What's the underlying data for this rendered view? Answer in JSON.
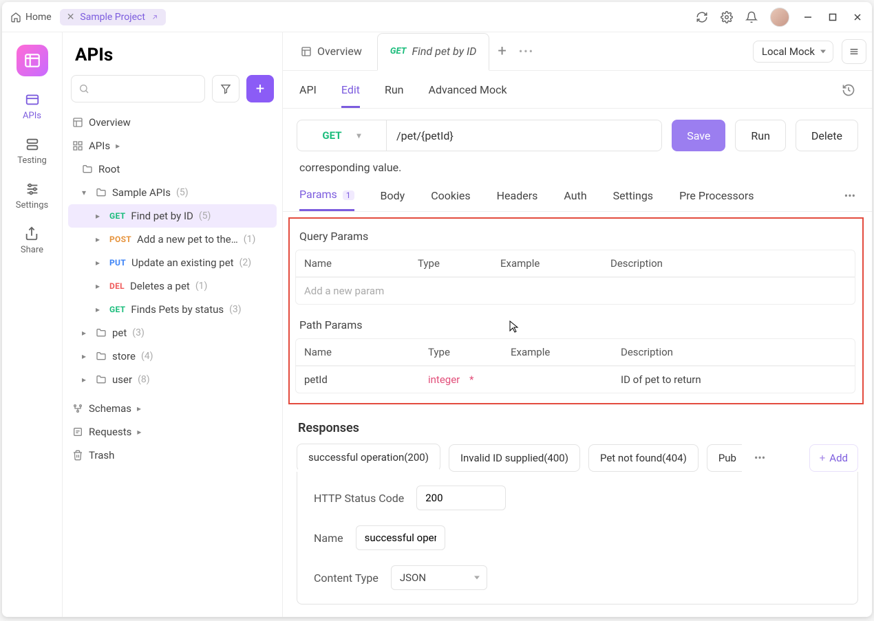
{
  "titlebar": {
    "home": "Home",
    "project_tab": "Sample Project"
  },
  "rail": {
    "items": [
      "APIs",
      "Testing",
      "Settings",
      "Share"
    ]
  },
  "sidebar": {
    "title": "APIs",
    "overview": "Overview",
    "apis_label": "APIs",
    "root": "Root",
    "sample_apis": {
      "label": "Sample APIs",
      "count": "(5)"
    },
    "endpoints": [
      {
        "method": "GET",
        "mclass": "m-get",
        "label": "Find pet by ID",
        "count": "(5)"
      },
      {
        "method": "POST",
        "mclass": "m-post",
        "label": "Add a new pet to the…",
        "count": "(1)"
      },
      {
        "method": "PUT",
        "mclass": "m-put",
        "label": "Update an existing pet",
        "count": "(2)"
      },
      {
        "method": "DEL",
        "mclass": "m-del",
        "label": "Deletes a pet",
        "count": "(1)"
      },
      {
        "method": "GET",
        "mclass": "m-get",
        "label": "Finds Pets by status",
        "count": "(3)"
      }
    ],
    "folders": [
      {
        "label": "pet",
        "count": "(3)"
      },
      {
        "label": "store",
        "count": "(4)"
      },
      {
        "label": "user",
        "count": "(8)"
      }
    ],
    "schemas": "Schemas",
    "requests": "Requests",
    "trash": "Trash"
  },
  "tabs": {
    "overview": "Overview",
    "active_method": "GET",
    "active_label": "Find pet by ID",
    "env": "Local Mock"
  },
  "inner_tabs": [
    "API",
    "Edit",
    "Run",
    "Advanced Mock"
  ],
  "action": {
    "method": "GET",
    "url": "/pet/{petId}",
    "save": "Save",
    "run": "Run",
    "delete": "Delete"
  },
  "description": "corresponding value.",
  "param_tabs": {
    "params": "Params",
    "params_count": "1",
    "body": "Body",
    "cookies": "Cookies",
    "headers": "Headers",
    "auth": "Auth",
    "settings": "Settings",
    "pre": "Pre Processors"
  },
  "query": {
    "section": "Query Params",
    "cols": {
      "name": "Name",
      "type": "Type",
      "example": "Example",
      "desc": "Description"
    },
    "placeholder": "Add a new param"
  },
  "path": {
    "section": "Path Params",
    "cols": {
      "name": "Name",
      "type": "Type",
      "example": "Example",
      "desc": "Description"
    },
    "row": {
      "name": "petId",
      "type": "integer",
      "example": "",
      "desc": "ID of pet to return"
    }
  },
  "responses": {
    "heading": "Responses",
    "tabs": [
      "successful operation(200)",
      "Invalid ID supplied(400)",
      "Pet not found(404)",
      "Pub"
    ],
    "add": "Add",
    "status_label": "HTTP Status Code",
    "status_value": "200",
    "name_label": "Name",
    "name_value": "successful oper",
    "ctype_label": "Content Type",
    "ctype_value": "JSON"
  }
}
